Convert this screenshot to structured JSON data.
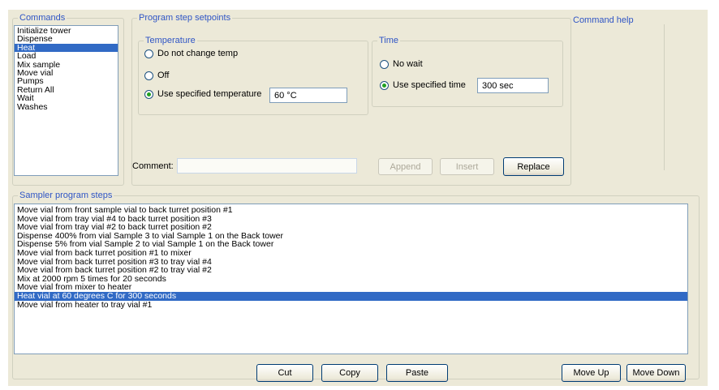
{
  "commands": {
    "title": "Commands",
    "items": [
      "Initialize tower",
      "Dispense",
      "Heat",
      "Load",
      "Mix sample",
      "Move vial",
      "Pumps",
      "Return All",
      "Wait",
      "Washes"
    ],
    "selected": 2
  },
  "setpoints": {
    "title": "Program step setpoints",
    "temperature": {
      "title": "Temperature",
      "options": [
        "Do not change temp",
        "Off",
        "Use specified temperature"
      ],
      "selected": 2,
      "value": "60 °C"
    },
    "time": {
      "title": "Time",
      "options": [
        "No wait",
        "Use specified time"
      ],
      "selected": 1,
      "value": "300 sec"
    },
    "comment_label": "Comment:",
    "comment_value": "",
    "buttons": {
      "append": "Append",
      "insert": "Insert",
      "replace": "Replace"
    }
  },
  "help": {
    "title": "Command help"
  },
  "steps": {
    "title": "Sampler program steps",
    "items": [
      "Move vial from front sample vial to back turret position #1",
      "Move vial from tray vial #4 to back turret position #3",
      "Move vial from tray vial #2 to back turret position #2",
      "Dispense 400% from vial Sample 3 to vial Sample 1 on the Back tower",
      "Dispense 5% from vial Sample 2 to vial Sample 1 on the Back tower",
      "Move vial from back turret position #1 to mixer",
      "Move vial from back turret position #3 to tray vial #4",
      "Move vial from back turret position #2 to tray vial #2",
      "Mix at 2000 rpm 5 times for 20 seconds",
      "Move vial from mixer to heater",
      "Heat vial at 60 degrees C for 300 seconds",
      "Move vial from heater to tray vial #1"
    ],
    "selected": 10
  },
  "bottom_buttons": {
    "cut": "Cut",
    "copy": "Copy",
    "paste": "Paste",
    "move_up": "Move Up",
    "move_down": "Move Down"
  }
}
